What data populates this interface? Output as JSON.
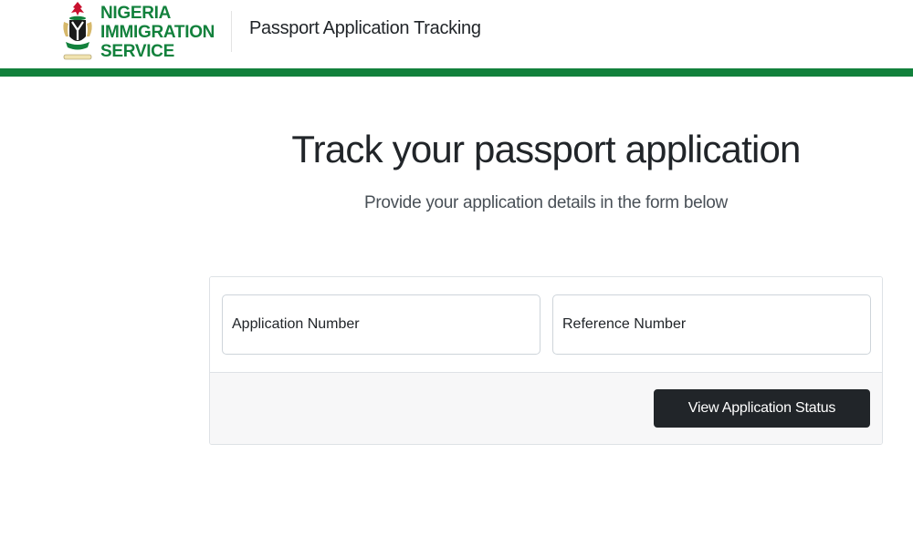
{
  "brand": {
    "logo_lines": [
      "NIGERIA",
      "IMMIGRATION",
      "SERVICE"
    ],
    "logo_icon": "coat-of-arms-icon",
    "primary_color": "#12813c",
    "crest_red": "#c8102e"
  },
  "header": {
    "title": "Passport Application Tracking"
  },
  "main": {
    "heading": "Track your passport application",
    "subtitle": "Provide your application details in the form below"
  },
  "form": {
    "application_number": {
      "placeholder": "Application Number",
      "value": ""
    },
    "reference_number": {
      "placeholder": "Reference Number",
      "value": ""
    },
    "submit_label": "View Application Status",
    "button_color": "#212529"
  }
}
